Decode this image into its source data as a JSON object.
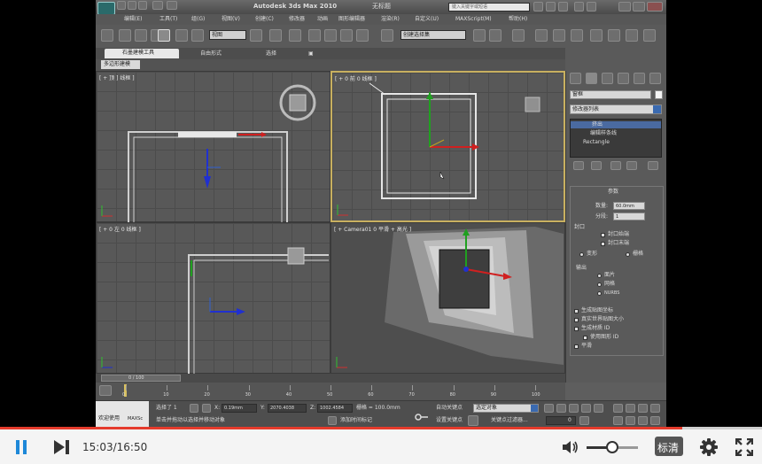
{
  "app": {
    "title": "Autodesk 3ds Max  2010",
    "doc_name": "无标题",
    "search_placeholder": "键入关键字或短语",
    "menu": [
      "编辑(E)",
      "工具(T)",
      "组(G)",
      "视图(V)",
      "创建(C)",
      "修改器",
      "动画",
      "图形编辑器",
      "渲染(R)",
      "自定义(U)",
      "MAXScript(M)",
      "帮助(H)"
    ],
    "toolbar_dropdown_view": "视图",
    "toolbar_dropdown_sel": "创建选择集",
    "ribbon_tabs": [
      "石墨建模工具",
      "自由形式",
      "选择",
      "▣"
    ],
    "ribbon_sub": "多边形建模"
  },
  "viewports": {
    "top": "[ + 顶 ] 线框 ]",
    "front": "[ + 0 前 0 线框 ]",
    "left": "[ + 0 左 0 线框 ]",
    "camera": "[ + Camera01 0 平滑 + 高光 ]"
  },
  "command_panel": {
    "object_name": "窗框",
    "modifier_list": "修改器列表",
    "stack": [
      "挤出",
      "编辑样条线",
      "Rectangle"
    ],
    "params_title": "参数",
    "amount_label": "数量:",
    "amount_value": "60.0mm",
    "segments_label": "分段:",
    "segments_value": "1",
    "cap_label": "封口",
    "cap_start": "封口始端",
    "cap_end": "封口末端",
    "morph": "变形",
    "grid": "栅格",
    "output_label": "输出",
    "output_patch": "面片",
    "output_mesh": "网格",
    "output_nurbs": "NURBS",
    "gen_mapping": "生成贴图坐标",
    "real_world": "真实世界贴图大小",
    "gen_mat_ids": "生成材质 ID",
    "use_shape_ids": "使用图形 ID",
    "smooth": "平滑"
  },
  "timeline": {
    "frame_counter": "0 / 100",
    "ticks": [
      "0",
      "10",
      "20",
      "30",
      "40",
      "50",
      "60",
      "70",
      "80",
      "90",
      "100"
    ]
  },
  "status": {
    "welcome": "欢迎使用",
    "maxscript": "MAXSc",
    "selected": "选择了 1",
    "prompt": "单击并拖动以选择并移动对象",
    "x_label": "X:",
    "x_value": "0.19mm",
    "y_label": "Y:",
    "y_value": "2070.4038",
    "z_label": "Z:",
    "z_value": "1002.4584",
    "grid_label": "栅格 = 100.0mm",
    "add_time_tag": "添加时间标记",
    "auto_key": "自动关键点",
    "set_key": "设置关键点",
    "selected_obj": "选定对象",
    "key_filters": "关键点过滤器...",
    "frame": "0"
  },
  "player": {
    "time": "15:03/16:50",
    "progress": 0.895,
    "volume": 0.5,
    "quality": "标清"
  }
}
